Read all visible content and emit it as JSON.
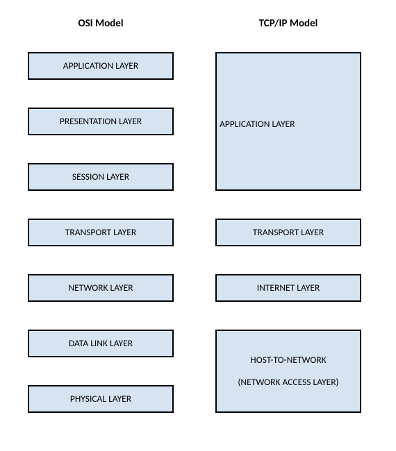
{
  "headers": {
    "osi": "OSI Model",
    "tcpip": "TCP/IP Model"
  },
  "osi": {
    "l7": "APPLICATION LAYER",
    "l6": "PRESENTATION LAYER",
    "l5": "SESSION LAYER",
    "l4": "TRANSPORT LAYER",
    "l3": "NETWORK LAYER",
    "l2": "DATA LINK LAYER",
    "l1": "PHYSICAL LAYER"
  },
  "tcpip": {
    "app": "APPLICATION LAYER",
    "transport": "TRANSPORT LAYER",
    "internet": "INTERNET LAYER",
    "host1": "HOST-TO-NETWORK",
    "host2": "(NETWORK ACCESS LAYER)"
  },
  "colors": {
    "box_fill": "#d6e4f2",
    "box_border": "#000000"
  }
}
